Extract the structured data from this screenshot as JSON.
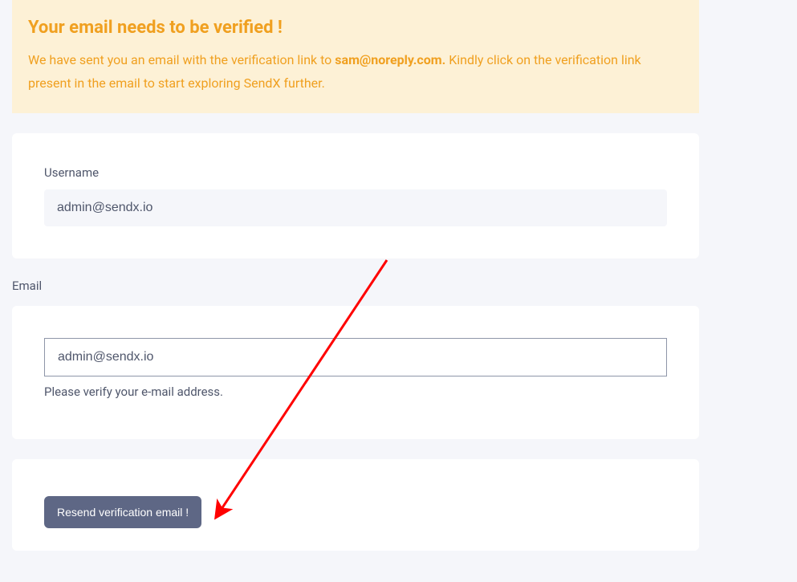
{
  "alert": {
    "title": "Your email needs to be verified !",
    "text_before": "We have sent you an email with the verification link to ",
    "email": "sam@noreply.com.",
    "text_after": " Kindly click on the verification link present in the email to start exploring SendX further."
  },
  "username": {
    "label": "Username",
    "value": "admin@sendx.io"
  },
  "email": {
    "label": "Email",
    "value": "admin@sendx.io",
    "help": "Please verify your e-mail address."
  },
  "button": {
    "resend_label": "Resend verification email !"
  }
}
